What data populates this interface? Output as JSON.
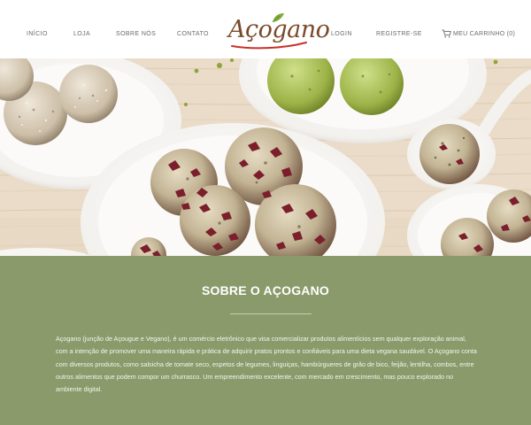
{
  "nav": {
    "items": [
      {
        "label": "INÍCIO"
      },
      {
        "label": "LOJA"
      },
      {
        "label": "SOBRE NÓS"
      },
      {
        "label": "CONTATO"
      },
      {
        "label": "LOGIN"
      },
      {
        "label": "REGISTRE-SE"
      }
    ],
    "cart_label": "MEU CARRINHO (0)"
  },
  "logo": {
    "text": "Açogano",
    "colors": {
      "text": "#7a4a2a",
      "leaf": "#7dab3a",
      "swoosh": "#c8322a"
    }
  },
  "about": {
    "title": "SOBRE O AÇOGANO",
    "body": "Açogano (junção de Açougue e Vegano), é um comércio eletrônico que visa comercializar produtos alimentícios sem qualquer exploração animal, com a intenção de promover uma maneira rápida e prática de adquirir pratos prontos e confiáveis para uma dieta vegana saudável. O Açogano conta com diversos produtos, como salsicha de tomate seco, espetos de legumes, linguiças, hambúrgueres de grão de bico, feijão, lentilha, combos, entre outros alimentos que podem compor um churrasco. Um empreendimento excelente, com mercado em crescimento, mas pouco explorado no ambiente digital.",
    "background": "#8a9a6b"
  }
}
